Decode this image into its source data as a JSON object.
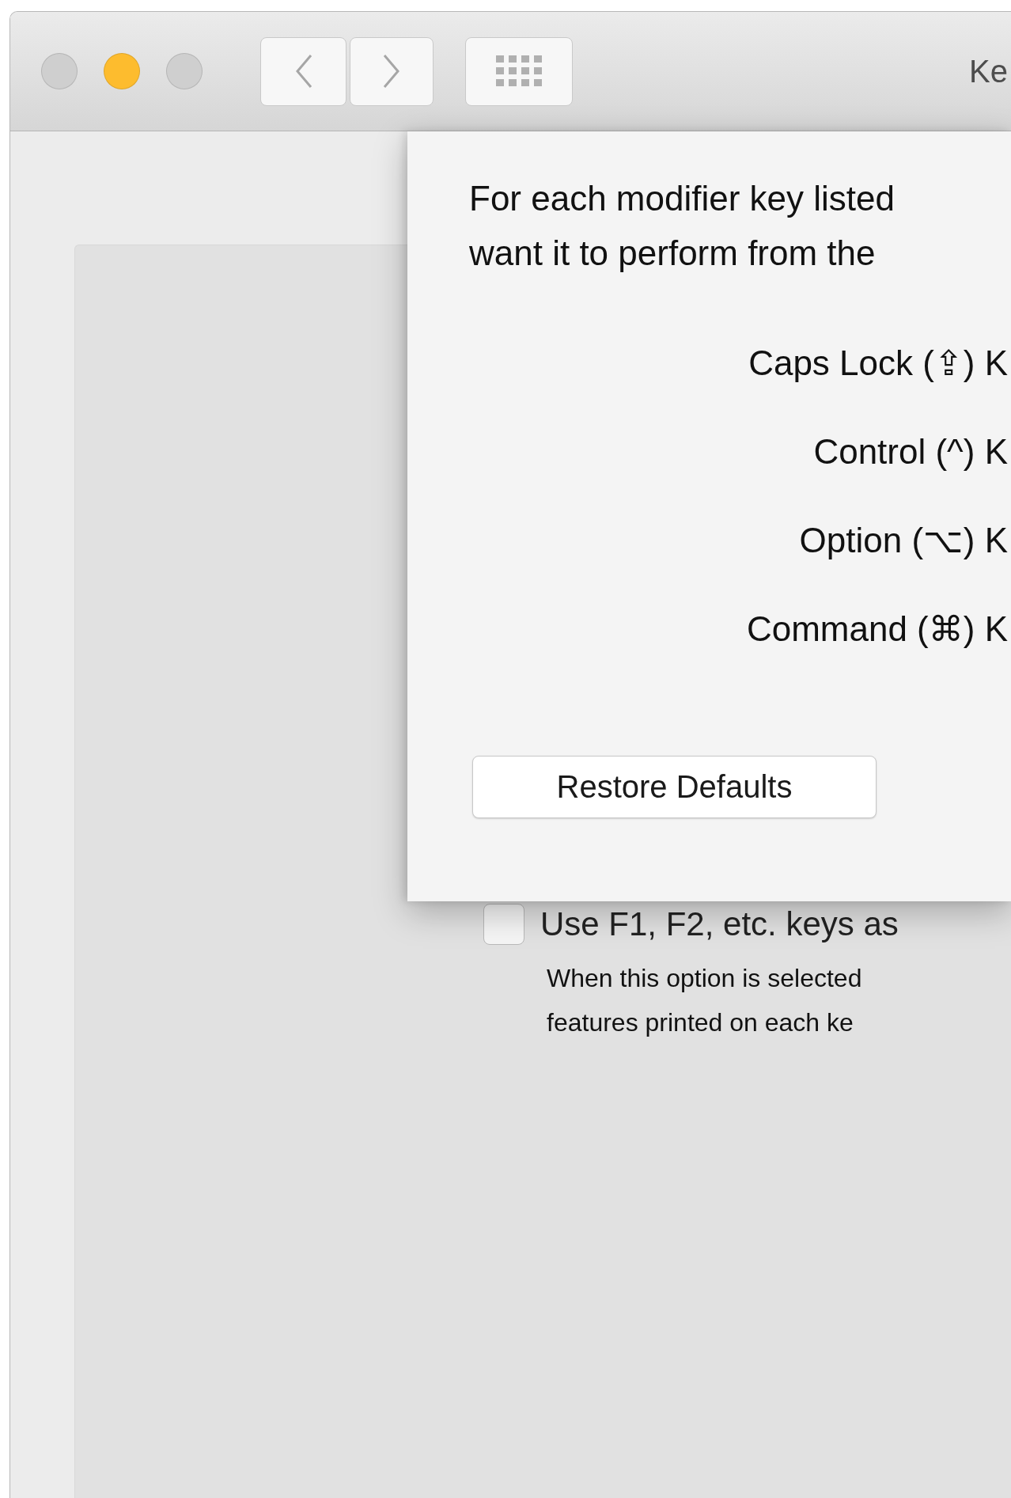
{
  "window": {
    "title": "Ke",
    "window_controls": [
      {
        "color": "#cfcfcf"
      },
      {
        "color": "#fdbc2e"
      },
      {
        "color": "#cfcfcf"
      }
    ]
  },
  "content": {
    "checkbox": {
      "label": "Use F1, F2, etc. keys as",
      "checked": false
    },
    "description": [
      "When this option is selected",
      "features printed on each ke"
    ]
  },
  "sheet": {
    "description": [
      "For each modifier key listed",
      "want it to perform from the"
    ],
    "modifier_keys": [
      {
        "label": "Caps Lock (⇪) K"
      },
      {
        "label": "Control (^) K"
      },
      {
        "label": "Option (⌥) K"
      },
      {
        "label": "Command (⌘) K"
      }
    ],
    "restore_button": "Restore Defaults"
  }
}
